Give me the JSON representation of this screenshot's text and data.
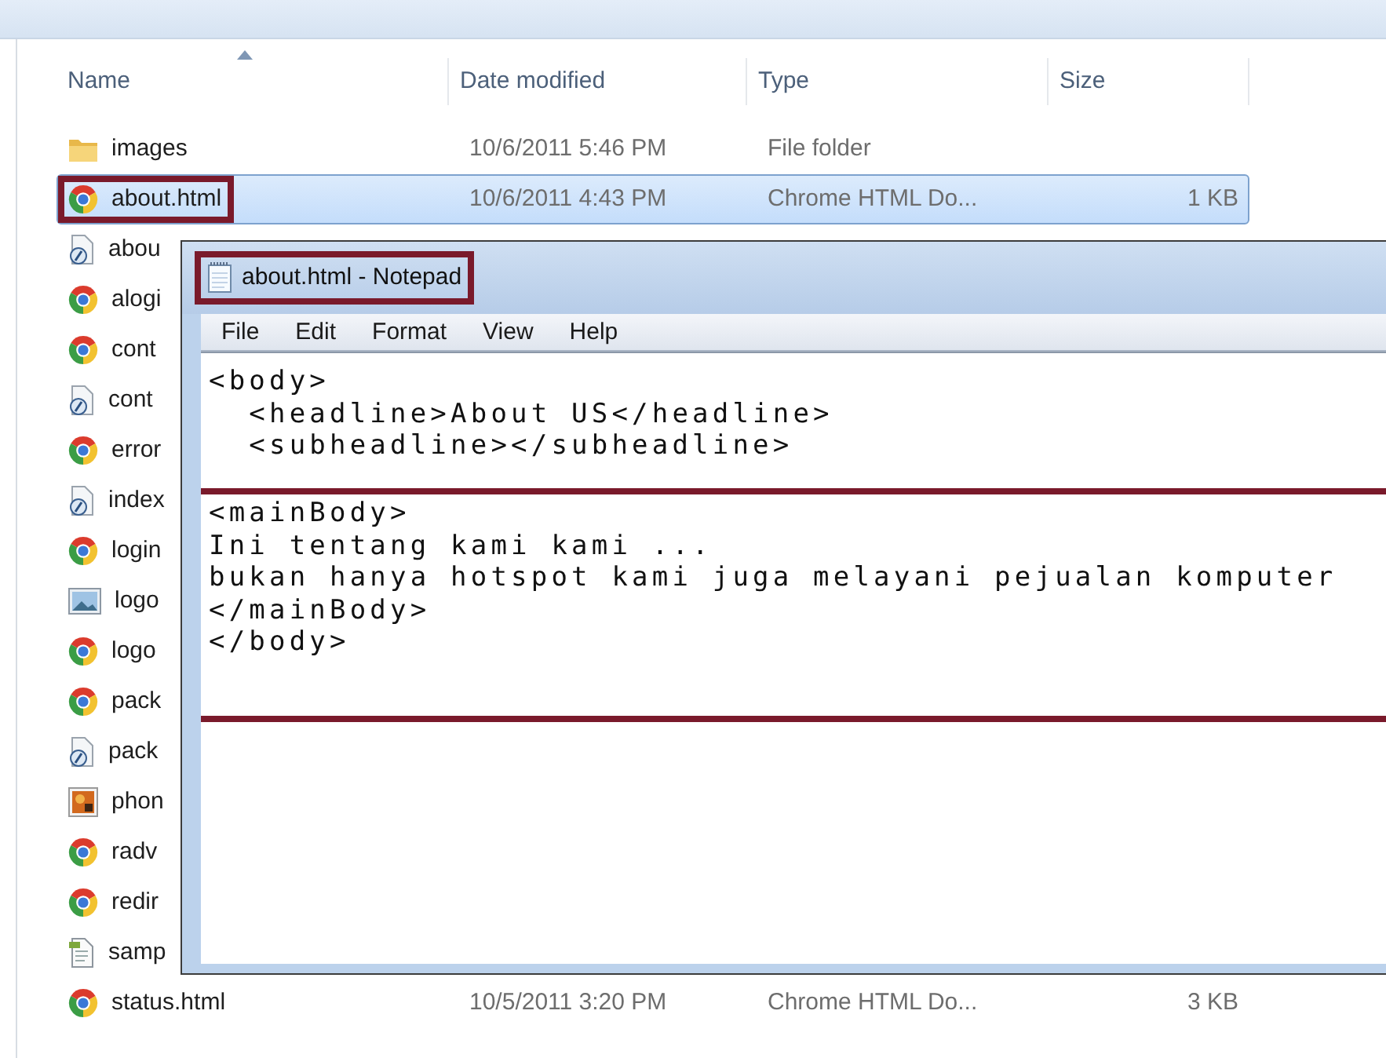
{
  "explorer": {
    "columns": [
      "Name",
      "Date modified",
      "Type",
      "Size"
    ],
    "files": [
      {
        "name": "images",
        "kind": "folder",
        "modified": "10/6/2011 5:46 PM",
        "type": "File folder",
        "selected": false,
        "highlighted": false
      },
      {
        "name": "about.html",
        "kind": "chrome",
        "modified": "10/6/2011 4:43 PM",
        "type": "Chrome HTML Do...",
        "size": "1 KB",
        "selected": true,
        "highlighted": true
      },
      {
        "name": "abou",
        "kind": "script",
        "selected": false,
        "highlighted": false
      },
      {
        "name": "alogi",
        "kind": "chrome",
        "selected": false,
        "highlighted": false
      },
      {
        "name": "cont",
        "kind": "chrome",
        "selected": false,
        "highlighted": false
      },
      {
        "name": "cont",
        "kind": "script",
        "selected": false,
        "highlighted": false
      },
      {
        "name": "error",
        "kind": "chrome",
        "selected": false,
        "highlighted": false
      },
      {
        "name": "index",
        "kind": "script",
        "selected": false,
        "highlighted": false
      },
      {
        "name": "login",
        "kind": "chrome",
        "selected": false,
        "highlighted": false
      },
      {
        "name": "logo",
        "kind": "image",
        "selected": false,
        "highlighted": false
      },
      {
        "name": "logo",
        "kind": "chrome",
        "selected": false,
        "highlighted": false
      },
      {
        "name": "pack",
        "kind": "chrome",
        "selected": false,
        "highlighted": false
      },
      {
        "name": "pack",
        "kind": "script",
        "selected": false,
        "highlighted": false
      },
      {
        "name": "phon",
        "kind": "photo",
        "selected": false,
        "highlighted": false
      },
      {
        "name": "radv",
        "kind": "chrome",
        "selected": false,
        "highlighted": false
      },
      {
        "name": "redir",
        "kind": "chrome",
        "selected": false,
        "highlighted": false
      },
      {
        "name": "samp",
        "kind": "text",
        "selected": false,
        "highlighted": false
      },
      {
        "name": "status.html",
        "kind": "chrome",
        "modified": "10/5/2011 3:20 PM",
        "type": "Chrome HTML Do...",
        "size": "3 KB",
        "selected": false,
        "highlighted": false
      }
    ]
  },
  "notepad": {
    "title": "about.html - Notepad",
    "title_highlighted": true,
    "menu": [
      "File",
      "Edit",
      "Format",
      "View",
      "Help"
    ],
    "lines": [
      {
        "kind": "text",
        "text": "<body>",
        "highlighted": false
      },
      {
        "kind": "text",
        "text": "  <headline>About US</headline>",
        "highlighted": false
      },
      {
        "kind": "text",
        "text": "  <subheadline></subheadline>",
        "highlighted": false
      },
      {
        "kind": "blank"
      },
      {
        "kind": "text",
        "text": "<mainBody>",
        "highlighted": true
      },
      {
        "kind": "text",
        "text": "Ini tentang kami kami ...",
        "highlighted": true
      },
      {
        "kind": "text",
        "text": "bukan hanya hotspot kami juga melayani pejualan komputer",
        "highlighted": true
      },
      {
        "kind": "text",
        "text": "</mainBody>",
        "highlighted": true
      },
      {
        "kind": "text",
        "text": "</body>",
        "highlighted": true
      }
    ]
  }
}
